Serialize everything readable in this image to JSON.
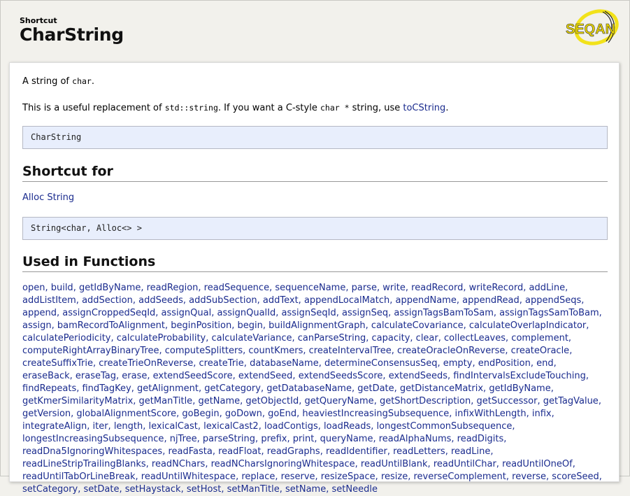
{
  "header": {
    "kicker": "Shortcut",
    "title": "CharString",
    "logo_text": "SEQAN"
  },
  "intro": {
    "summary_prefix": "A string of ",
    "summary_code": "char",
    "summary_suffix": ".",
    "desc_prefix": "This is a useful replacement of ",
    "desc_code1": "std::string",
    "desc_mid": ". If you want a C-style ",
    "desc_code2": "char *",
    "desc_mid2": " string, use ",
    "desc_link": "toCString",
    "desc_suffix": "."
  },
  "signature": "CharString",
  "shortcut_for": {
    "heading": "Shortcut for",
    "link": "Alloc String",
    "code": "String<char, Alloc<> >"
  },
  "used_in": {
    "heading": "Used in Functions",
    "functions": [
      "open",
      "build",
      "getIdByName",
      "readRegion",
      "readSequence",
      "sequenceName",
      "parse",
      "write",
      "readRecord",
      "writeRecord",
      "addLine",
      "addListItem",
      "addSection",
      "addSeeds",
      "addSubSection",
      "addText",
      "appendLocalMatch",
      "appendName",
      "appendRead",
      "appendSeqs",
      "append",
      "assignCroppedSeqId",
      "assignQual",
      "assignQualId",
      "assignSeqId",
      "assignSeq",
      "assignTagsBamToSam",
      "assignTagsSamToBam",
      "assign",
      "bamRecordToAlignment",
      "beginPosition",
      "begin",
      "buildAlignmentGraph",
      "calculateCovariance",
      "calculateOverlapIndicator",
      "calculatePeriodicity",
      "calculateProbability",
      "calculateVariance",
      "canParseString",
      "capacity",
      "clear",
      "collectLeaves",
      "complement",
      "computeRightArrayBinaryTree",
      "computeSplitters",
      "countKmers",
      "createIntervalTree",
      "createOracleOnReverse",
      "createOracle",
      "createSuffixTrie",
      "createTrieOnReverse",
      "createTrie",
      "databaseName",
      "determineConsensusSeq",
      "empty",
      "endPosition",
      "end",
      "eraseBack",
      "eraseTag",
      "erase",
      "extendSeedScore",
      "extendSeed",
      "extendSeedsScore",
      "extendSeeds",
      "findIntervalsExcludeTouching",
      "findRepeats",
      "findTagKey",
      "getAlignment",
      "getCategory",
      "getDatabaseName",
      "getDate",
      "getDistanceMatrix",
      "getIdByName",
      "getKmerSimilarityMatrix",
      "getManTitle",
      "getName",
      "getObjectId",
      "getQueryName",
      "getShortDescription",
      "getSuccessor",
      "getTagValue",
      "getVersion",
      "globalAlignmentScore",
      "goBegin",
      "goDown",
      "goEnd",
      "heaviestIncreasingSubsequence",
      "infixWithLength",
      "infix",
      "integrateAlign",
      "iter",
      "length",
      "lexicalCast",
      "lexicalCast2",
      "loadContigs",
      "loadReads",
      "longestCommonSubsequence",
      "longestIncreasingSubsequence",
      "njTree",
      "parseString",
      "prefix",
      "print",
      "queryName",
      "readAlphaNums",
      "readDigits",
      "readDna5IgnoringWhitespaces",
      "readFasta",
      "readFloat",
      "readGraphs",
      "readIdentifier",
      "readLetters",
      "readLine",
      "readLineStripTrailingBlanks",
      "readNChars",
      "readNCharsIgnoringWhitespace",
      "readUntilBlank",
      "readUntilChar",
      "readUntilOneOf",
      "readUntilTabOrLineBreak",
      "readUntilWhitespace",
      "replace",
      "reserve",
      "resizeSpace",
      "resize",
      "reverseComplement",
      "reverse",
      "scoreSeed",
      "setCategory",
      "setDate",
      "setHaystack",
      "setHost",
      "setManTitle",
      "setName",
      "setNeedle"
    ]
  },
  "colors": {
    "link": "#1a2b8e",
    "code_bg": "#e8eefc",
    "page_bg": "#f2f1ec",
    "logo_yellow": "#f2e21a"
  }
}
